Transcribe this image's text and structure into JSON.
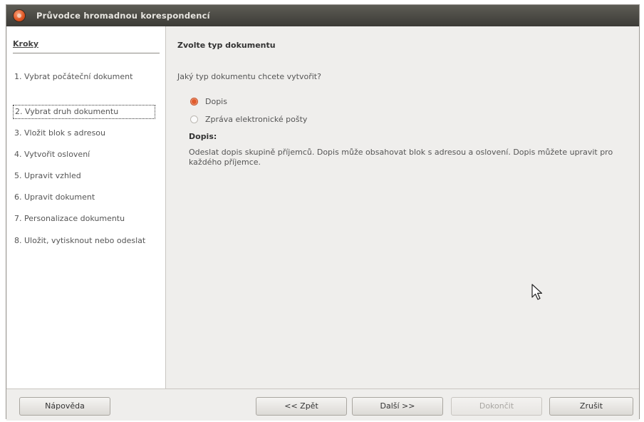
{
  "window": {
    "title": "Průvodce hromadnou korespondencí"
  },
  "sidebar": {
    "heading": "Kroky",
    "steps": [
      {
        "label": "1. Vybrat počáteční dokument"
      },
      {
        "label": "2. Vybrat druh dokumentu"
      },
      {
        "label": "3. Vložit blok s adresou"
      },
      {
        "label": "4. Vytvořit oslovení"
      },
      {
        "label": "5. Upravit vzhled"
      },
      {
        "label": "6. Upravit dokument"
      },
      {
        "label": "7. Personalizace dokumentu"
      },
      {
        "label": "8. Uložit, vytisknout nebo odeslat"
      }
    ]
  },
  "main": {
    "title": "Zvolte typ dokumentu",
    "question": "Jaký typ dokumentu chcete vytvořit?",
    "options": [
      {
        "label": "Dopis",
        "selected": true
      },
      {
        "label": "Zpráva elektronické pošty",
        "selected": false
      }
    ],
    "description_title": "Dopis:",
    "description_text": "Odeslat dopis skupině příjemců. Dopis může obsahovat blok s adresou a oslovení. Dopis můžete upravit pro každého příjemce."
  },
  "buttons": {
    "help": "Nápověda",
    "back": "<< Zpět",
    "next": "Další >>",
    "finish": "Dokončit",
    "cancel": "Zrušit"
  },
  "colors": {
    "accent": "#e05b2c",
    "titlebar": "#3c3b37"
  }
}
